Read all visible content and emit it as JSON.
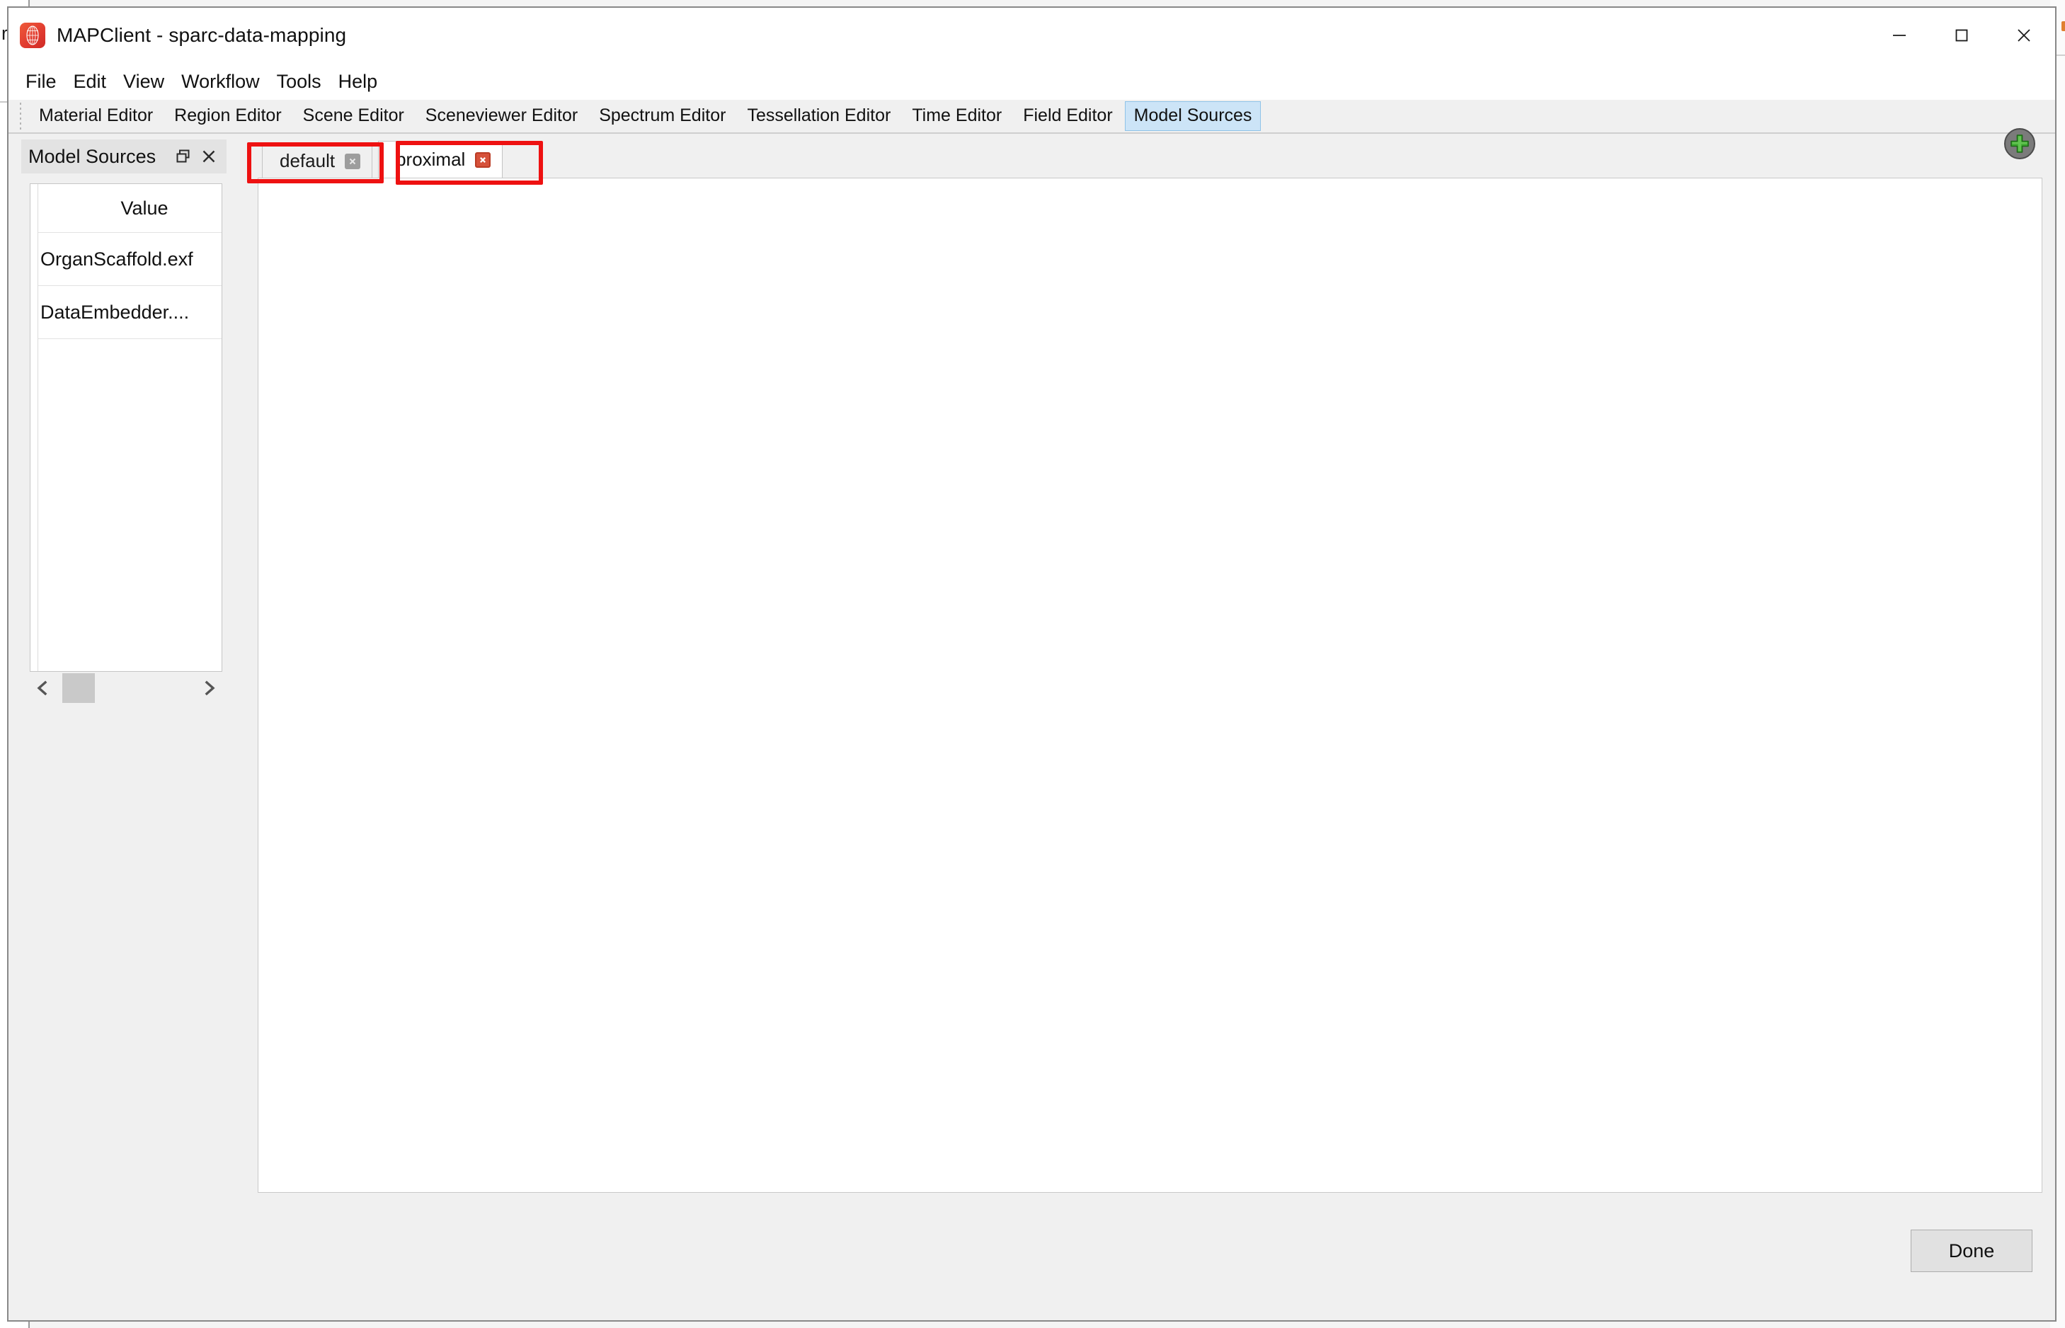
{
  "background": {
    "left_window_fragment_text": "r"
  },
  "window": {
    "title": "MAPClient - sparc-data-mapping",
    "app_icon": "mapclient-logo-icon",
    "controls": {
      "minimize": "minimize-icon",
      "maximize": "maximize-icon",
      "close": "close-icon"
    }
  },
  "menu": {
    "items": [
      {
        "label": "File"
      },
      {
        "label": "Edit"
      },
      {
        "label": "View"
      },
      {
        "label": "Workflow"
      },
      {
        "label": "Tools"
      },
      {
        "label": "Help"
      }
    ]
  },
  "editor_tabs": {
    "items": [
      {
        "label": "Material Editor",
        "selected": false
      },
      {
        "label": "Region Editor",
        "selected": false
      },
      {
        "label": "Scene Editor",
        "selected": false
      },
      {
        "label": "Sceneviewer Editor",
        "selected": false
      },
      {
        "label": "Spectrum Editor",
        "selected": false
      },
      {
        "label": "Tessellation Editor",
        "selected": false
      },
      {
        "label": "Time Editor",
        "selected": false
      },
      {
        "label": "Field Editor",
        "selected": false
      },
      {
        "label": "Model Sources",
        "selected": true
      }
    ],
    "selected_label": "Model Sources",
    "selected_bg": "#cce4f7",
    "selected_border": "#8fc3e8"
  },
  "dock": {
    "title": "Model Sources",
    "float_icon": "restore-window-icon",
    "close_icon": "close-icon",
    "table": {
      "columns": [
        "Value"
      ],
      "rows": [
        [
          "OrganScaffold.exf"
        ],
        [
          "DataEmbedder...."
        ]
      ]
    },
    "scrollbar": {
      "left_arrow": "chevron-left-icon",
      "right_arrow": "chevron-right-icon"
    }
  },
  "sources": {
    "tabs": [
      {
        "label": "default",
        "active": false,
        "close_icon": "close-icon",
        "close_style": "gray",
        "highlighted": true
      },
      {
        "label": "proximal",
        "active": true,
        "close_icon": "close-icon",
        "close_style": "red",
        "highlighted": true
      }
    ],
    "add_button": {
      "icon": "plus-icon",
      "color": "#3faa32"
    },
    "page_content": ""
  },
  "footer": {
    "done_label": "Done"
  },
  "annotations": {
    "highlight_color": "#ee1111",
    "boxes": [
      {
        "target": "default-tab"
      },
      {
        "target": "proximal-tab"
      }
    ]
  }
}
